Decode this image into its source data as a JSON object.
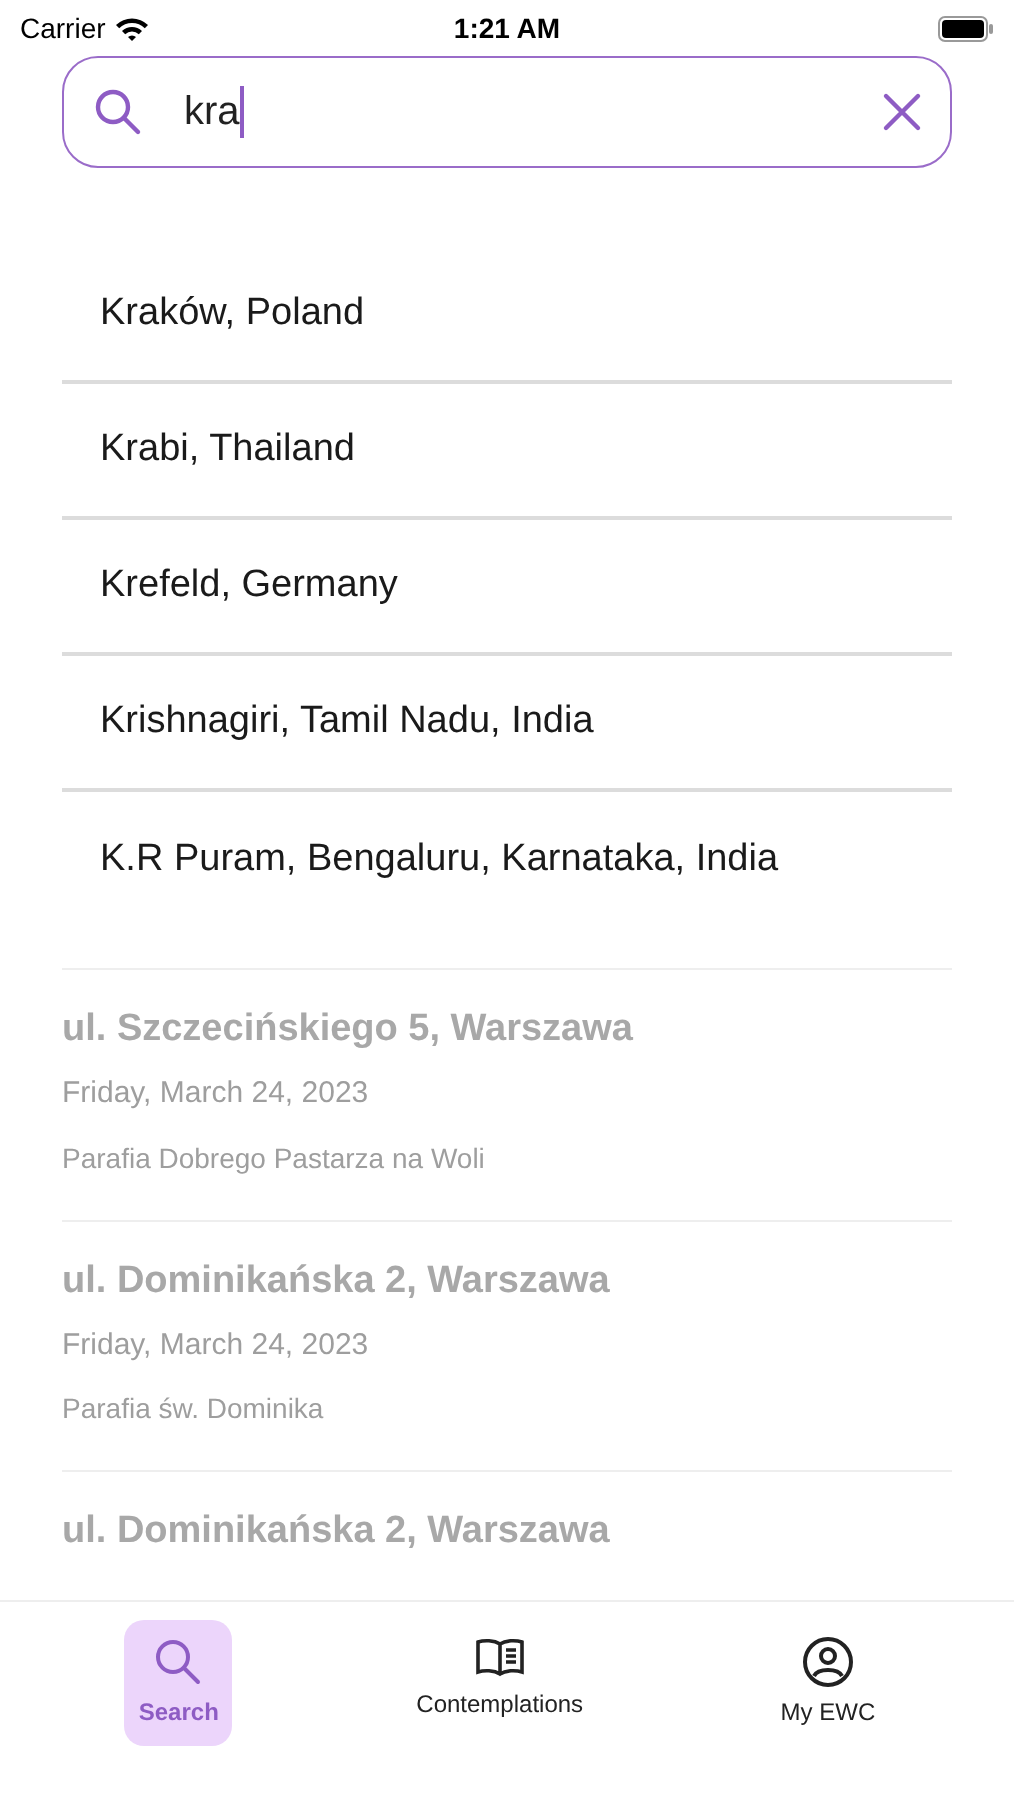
{
  "status_bar": {
    "carrier": "Carrier",
    "time": "1:21 AM"
  },
  "search": {
    "value": "kra"
  },
  "suggestions": [
    "Kraków, Poland",
    "Krabi, Thailand",
    "Krefeld, Germany",
    "Krishnagiri, Tamil Nadu, India",
    "K.R Puram, Bengaluru, Karnataka, India"
  ],
  "results": [
    {
      "title": "ul. Szczecińskiego 5, Warszawa",
      "date": "Friday, March 24, 2023",
      "parish": "Parafia Dobrego Pastarza na Woli"
    },
    {
      "title": "ul. Dominikańska 2, Warszawa",
      "date": "Friday, March 24, 2023",
      "parish": "Parafia św. Dominika"
    },
    {
      "title": "ul. Dominikańska 2, Warszawa"
    }
  ],
  "tabs": [
    {
      "label": "Search",
      "kind": "search",
      "selected": true
    },
    {
      "label": "Contemplations",
      "kind": "book",
      "selected": false
    },
    {
      "label": "My EWC",
      "kind": "profile",
      "selected": false
    }
  ]
}
